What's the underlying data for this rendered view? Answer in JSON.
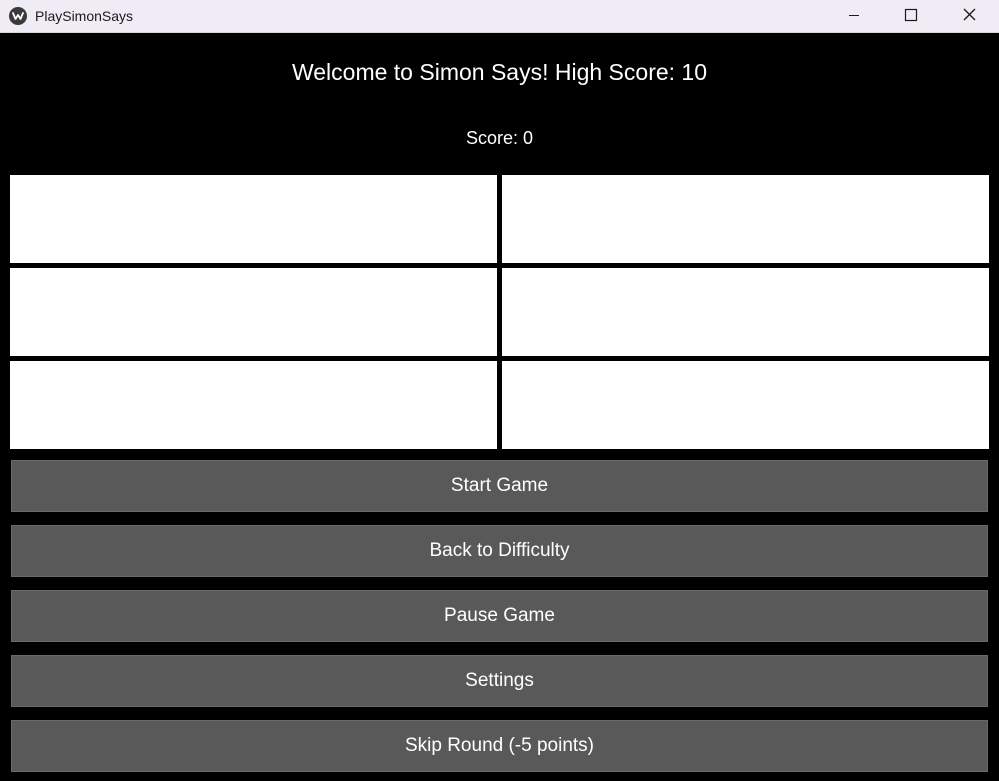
{
  "window": {
    "title": "PlaySimonSays",
    "controls": {
      "minimize_icon": "minimize-icon",
      "maximize_icon": "maximize-icon",
      "close_icon": "close-icon"
    }
  },
  "header": {
    "welcome_text": "Welcome to Simon Says! High Score: 10",
    "score_text": "Score: 0"
  },
  "grid": {
    "tiles": [
      {
        "id": "tile-1",
        "color": "#ffffff"
      },
      {
        "id": "tile-2",
        "color": "#ffffff"
      },
      {
        "id": "tile-3",
        "color": "#ffffff"
      },
      {
        "id": "tile-4",
        "color": "#ffffff"
      },
      {
        "id": "tile-5",
        "color": "#ffffff"
      },
      {
        "id": "tile-6",
        "color": "#ffffff"
      }
    ]
  },
  "buttons": {
    "start": "Start Game",
    "back": "Back to Difficulty",
    "pause": "Pause Game",
    "settings": "Settings",
    "skip": "Skip Round (-5 points)"
  },
  "colors": {
    "background": "#000000",
    "titlebar": "#efecf5",
    "button": "#595959",
    "tile": "#ffffff",
    "text": "#ffffff"
  }
}
